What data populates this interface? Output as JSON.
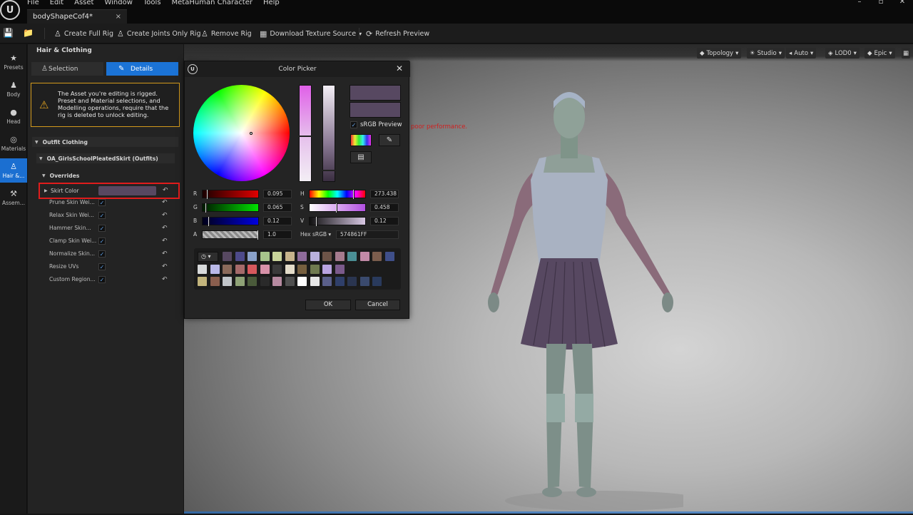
{
  "menu": {
    "items": [
      "File",
      "Edit",
      "Asset",
      "Window",
      "Tools",
      "MetaHuman Character",
      "Help"
    ]
  },
  "window_controls": [
    "–",
    "▫",
    "✕"
  ],
  "tab": {
    "title": "bodyShapeCof4*",
    "close": "×"
  },
  "toolbar": {
    "create_full_rig": "Create Full Rig",
    "create_joints_only_rig": "Create Joints Only Rig",
    "remove_rig": "Remove Rig",
    "download_texture_source": "Download Texture Source",
    "refresh_preview": "Refresh Preview"
  },
  "iconbar": {
    "presets": "Presets",
    "body": "Body",
    "head": "Head",
    "materials": "Materials",
    "hair": "Hair &...",
    "assembly": "Assem..."
  },
  "panel": {
    "title": "Hair & Clothing",
    "selection_tab": "Selection",
    "details_tab": "Details",
    "warning": "The Asset you're editing is rigged. Preset and Material selections, and Modelling operations, require that the rig is deleted to unlock editing.",
    "outfit_section": "Outfit Clothing",
    "outfit_name": "OA_GirlsSchoolPleatedSkirt (Outfits)",
    "overrides": "Overrides",
    "skirt_color_label": "Skirt Color",
    "skirt_color": "#574861",
    "rows": [
      {
        "label": "Prune Skin Wei...",
        "checked": "✓"
      },
      {
        "label": "Relax Skin Wei...",
        "checked": "✓"
      },
      {
        "label": "Hammer Skin...",
        "checked": "✓"
      },
      {
        "label": "Clamp Skin Wei...",
        "checked": "✓"
      },
      {
        "label": "Normalize Skin...",
        "checked": "✓"
      },
      {
        "label": "Resize UVs",
        "checked": "✓"
      },
      {
        "label": "Custom Region...",
        "checked": "✓"
      }
    ]
  },
  "viewport": {
    "topology": "Topology",
    "studio": "Studio",
    "auto": "Auto",
    "lod": "LOD0",
    "quality": "Epic",
    "warning_text": "poor performance."
  },
  "color_picker": {
    "title": "Color Picker",
    "srgb_preview": "sRGB Preview",
    "current_color": "#574861",
    "r_label": "R",
    "r_value": "0.095",
    "g_label": "G",
    "g_value": "0.065",
    "b_label": "B",
    "b_value": "0.12",
    "a_label": "A",
    "a_value": "1.0",
    "h_label": "H",
    "h_value": "273.438",
    "s_label": "S",
    "s_value": "0.458",
    "v_label": "V",
    "v_value": "0.12",
    "hex_label": "Hex sRGB",
    "hex_value": "574861FF",
    "ok": "OK",
    "cancel": "Cancel",
    "swatch_colors": [
      "#574861",
      "#4d4a8a",
      "#8aa1c9",
      "#a7c48b",
      "#c8d39a",
      "#c7b48c",
      "#8f6c9a",
      "#b9b0dc",
      "#6d5448",
      "#a57b8e",
      "#4a8f95",
      "#c28aa7",
      "#7b5d4d",
      "#3f4f8a",
      "#9aa0a8",
      "#d8dadb",
      "#b9b8e8",
      "#8a6a5a",
      "#a56a6a",
      "#d6585d",
      "#d791a8",
      "#3a3a3a",
      "#e4dcc9",
      "#765f3f",
      "#6f7a50",
      "#b9a3e0",
      "#7b5a8b",
      "#c2b47c",
      "#8a5e4e",
      "#c1c5c9",
      "#8fa276",
      "#4a5a3a",
      "#2a2a2a",
      "#b68aa0",
      "#4f4f4f",
      "#ffffff",
      "#e5e5e5",
      "#5a5f8a",
      "#2f3f6a",
      "#2a3550",
      "#3a4a6e",
      "#293a5c"
    ]
  }
}
